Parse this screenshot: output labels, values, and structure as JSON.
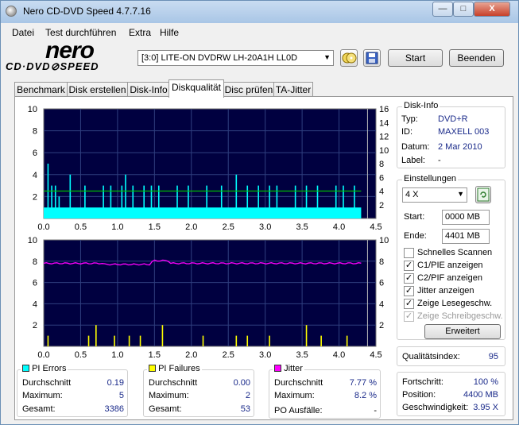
{
  "window": {
    "title": "Nero CD-DVD Speed 4.7.7.16",
    "min": "—",
    "max": "□",
    "close": "X"
  },
  "menu": [
    "Datei",
    "Test durchführen",
    "Extra",
    "Hilfe"
  ],
  "logo": {
    "main": "nero",
    "sub": "CD·DVD⊘SPEED"
  },
  "toolbar": {
    "drive": "[3:0]  LITE-ON DVDRW LH-20A1H LL0D",
    "start": "Start",
    "exit": "Beenden"
  },
  "tabs": [
    "Benchmark",
    "Disk erstellen",
    "Disk-Info",
    "Diskqualität",
    "Disc prüfen",
    "TA-Jitter"
  ],
  "colors": {
    "plot_bg": "#000040",
    "pie": "#00ffff",
    "pif": "#ffff00",
    "jitter": "#ff00ff",
    "speed": "#00c000",
    "grid": "#2f3f7f"
  },
  "chart_data": [
    {
      "type": "bar",
      "title": "PI Errors",
      "x_ticks": [
        "0.0",
        "0.5",
        "1.0",
        "1.5",
        "2.0",
        "2.5",
        "3.0",
        "3.5",
        "4.0",
        "4.5"
      ],
      "y_left_ticks": [
        "2",
        "4",
        "6",
        "8",
        "10"
      ],
      "y_right_ticks": [
        "2",
        "4",
        "6",
        "8",
        "10",
        "12",
        "14",
        "16"
      ],
      "xlim": [
        0,
        4.5
      ],
      "ylim": [
        0,
        10
      ],
      "y2lim": [
        0,
        16
      ],
      "series": [
        {
          "name": "PI Errors",
          "baseline": 1,
          "spikes": [
            [
              0.05,
              5
            ],
            [
              0.1,
              3
            ],
            [
              0.15,
              3
            ],
            [
              0.2,
              2
            ],
            [
              0.35,
              4
            ],
            [
              0.55,
              3
            ],
            [
              0.8,
              3
            ],
            [
              0.9,
              3
            ],
            [
              1.05,
              3
            ],
            [
              1.1,
              4
            ],
            [
              1.2,
              3
            ],
            [
              1.35,
              3
            ],
            [
              1.45,
              3
            ],
            [
              1.55,
              3
            ],
            [
              1.8,
              3
            ],
            [
              1.95,
              3
            ],
            [
              2.2,
              3
            ],
            [
              2.4,
              3
            ],
            [
              2.6,
              4
            ],
            [
              2.75,
              3
            ],
            [
              2.9,
              3
            ],
            [
              3.05,
              3
            ],
            [
              3.15,
              3
            ],
            [
              3.4,
              3
            ],
            [
              3.55,
              3
            ],
            [
              3.7,
              3
            ],
            [
              3.95,
              3
            ],
            [
              4.05,
              3
            ],
            [
              4.2,
              3
            ]
          ]
        }
      ],
      "speed_level": 4
    },
    {
      "type": "bar",
      "title": "PI Failures",
      "x_ticks": [
        "0.0",
        "0.5",
        "1.0",
        "1.5",
        "2.0",
        "2.5",
        "3.0",
        "3.5",
        "4.0",
        "4.5"
      ],
      "y_left_ticks": [
        "2",
        "4",
        "6",
        "8",
        "10"
      ],
      "y_right_ticks": [
        "2",
        "4",
        "6",
        "8",
        "10"
      ],
      "xlim": [
        0,
        4.5
      ],
      "ylim": [
        0,
        10
      ],
      "series": [
        {
          "name": "PI Failures",
          "spikes": [
            [
              0.05,
              1
            ],
            [
              0.6,
              1
            ],
            [
              0.7,
              2
            ],
            [
              0.95,
              1
            ],
            [
              1.15,
              1
            ],
            [
              1.3,
              1
            ],
            [
              1.6,
              2
            ],
            [
              2.15,
              1
            ],
            [
              2.6,
              1
            ],
            [
              2.75,
              1
            ],
            [
              3.05,
              1
            ],
            [
              3.55,
              2
            ],
            [
              3.75,
              1
            ],
            [
              4.1,
              1
            ]
          ]
        },
        {
          "name": "Jitter",
          "level": 7.8
        }
      ]
    }
  ],
  "disk_info": {
    "title": "Disk-Info",
    "rows": [
      {
        "label": "Typ:",
        "value": "DVD+R"
      },
      {
        "label": "ID:",
        "value": "MAXELL 003"
      },
      {
        "label": "Datum:",
        "value": "2 Mar 2010"
      },
      {
        "label": "Label:",
        "value": "-"
      }
    ]
  },
  "settings": {
    "title": "Einstellungen",
    "speed": "4 X",
    "start_label": "Start:",
    "start_value": "0000 MB",
    "end_label": "Ende:",
    "end_value": "4401 MB",
    "checks": [
      {
        "label": "Schnelles Scannen",
        "checked": false,
        "disabled": false
      },
      {
        "label": "C1/PIE anzeigen",
        "checked": true,
        "disabled": false
      },
      {
        "label": "C2/PIF anzeigen",
        "checked": true,
        "disabled": false
      },
      {
        "label": "Jitter anzeigen",
        "checked": true,
        "disabled": false
      },
      {
        "label": "Zeige Lesegeschw.",
        "checked": true,
        "disabled": false
      },
      {
        "label": "Zeige Schreibgeschw.",
        "checked": true,
        "disabled": true
      }
    ],
    "advanced": "Erweitert"
  },
  "quality": {
    "label": "Qualitätsindex:",
    "value": "95"
  },
  "progress": {
    "rows": [
      {
        "label": "Fortschritt:",
        "value": "100 %"
      },
      {
        "label": "Position:",
        "value": "4400 MB"
      },
      {
        "label": "Geschwindigkeit:",
        "value": "3.95 X"
      }
    ]
  },
  "pi_errors": {
    "title": "PI Errors",
    "rows": [
      {
        "label": "Durchschnitt",
        "value": "0.19"
      },
      {
        "label": "Maximum:",
        "value": "5"
      },
      {
        "label": "Gesamt:",
        "value": "3386"
      }
    ]
  },
  "pi_failures": {
    "title": "PI Failures",
    "rows": [
      {
        "label": "Durchschnitt",
        "value": "0.00"
      },
      {
        "label": "Maximum:",
        "value": "2"
      },
      {
        "label": "Gesamt:",
        "value": "53"
      }
    ]
  },
  "jitter": {
    "title": "Jitter",
    "rows": [
      {
        "label": "Durchschnitt",
        "value": "7.77 %"
      },
      {
        "label": "Maximum:",
        "value": "8.2 %"
      },
      {
        "label": "PO Ausfälle:",
        "value": "-"
      }
    ]
  }
}
